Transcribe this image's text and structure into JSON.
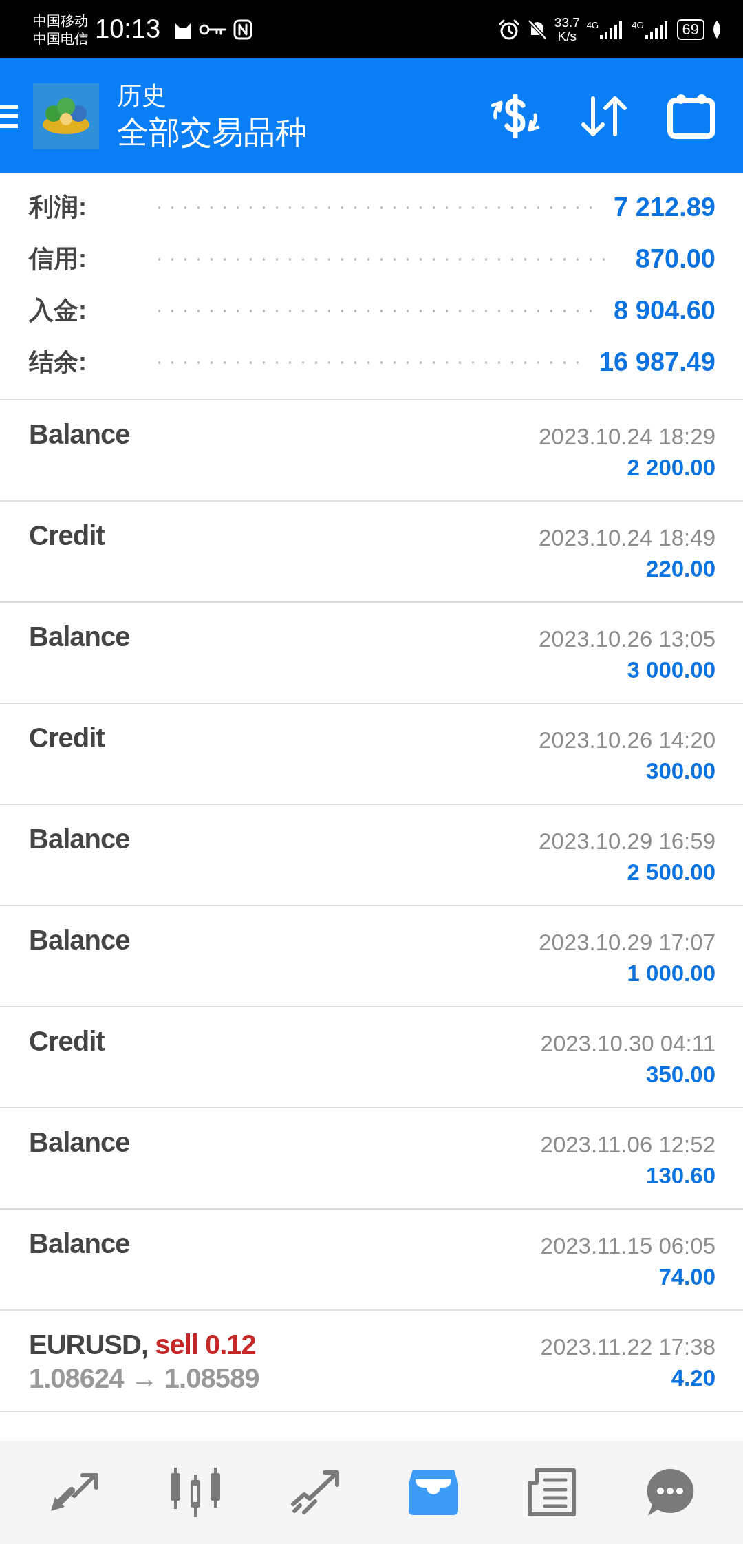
{
  "status_bar": {
    "carriers": [
      "中国移动",
      "中国电信"
    ],
    "time": "10:13",
    "speed": [
      "33.7",
      "K/s"
    ],
    "networks": [
      "4G",
      "4G"
    ],
    "battery": "69"
  },
  "header": {
    "title": "历史",
    "subtitle": "全部交易品种"
  },
  "summary": [
    {
      "label": "利润:",
      "value": "7 212.89"
    },
    {
      "label": "信用:",
      "value": "870.00"
    },
    {
      "label": "入金:",
      "value": "8 904.60"
    },
    {
      "label": "结余:",
      "value": "16 987.49"
    }
  ],
  "deals": [
    {
      "kind": "balance",
      "title": "Balance",
      "time": "2023.10.24 18:29",
      "amount": "2 200.00"
    },
    {
      "kind": "balance",
      "title": "Credit",
      "time": "2023.10.24 18:49",
      "amount": "220.00"
    },
    {
      "kind": "balance",
      "title": "Balance",
      "time": "2023.10.26 13:05",
      "amount": "3 000.00"
    },
    {
      "kind": "balance",
      "title": "Credit",
      "time": "2023.10.26 14:20",
      "amount": "300.00"
    },
    {
      "kind": "balance",
      "title": "Balance",
      "time": "2023.10.29 16:59",
      "amount": "2 500.00"
    },
    {
      "kind": "balance",
      "title": "Balance",
      "time": "2023.10.29 17:07",
      "amount": "1 000.00"
    },
    {
      "kind": "balance",
      "title": "Credit",
      "time": "2023.10.30 04:11",
      "amount": "350.00"
    },
    {
      "kind": "balance",
      "title": "Balance",
      "time": "2023.11.06 12:52",
      "amount": "130.60"
    },
    {
      "kind": "balance",
      "title": "Balance",
      "time": "2023.11.15 06:05",
      "amount": "74.00"
    },
    {
      "kind": "trade",
      "title": "EURUSD,",
      "action": "sell 0.12",
      "prices": "1.08624 → 1.08589",
      "time": "2023.11.22 17:38",
      "amount": "4.20"
    }
  ],
  "bottom_nav": [
    {
      "kind": "quotes",
      "selected": false
    },
    {
      "kind": "chart",
      "selected": false
    },
    {
      "kind": "trade",
      "selected": false
    },
    {
      "kind": "history",
      "selected": true
    },
    {
      "kind": "news",
      "selected": false
    },
    {
      "kind": "chat",
      "selected": false
    }
  ]
}
